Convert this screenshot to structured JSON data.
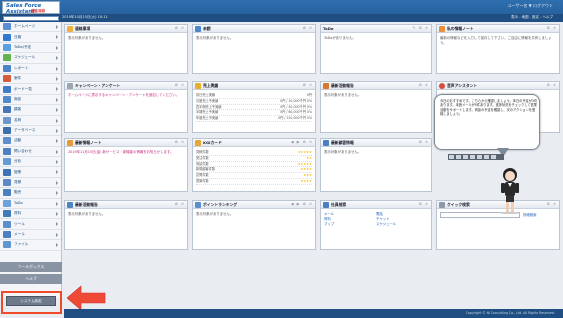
{
  "header": {
    "logo": "Sales Force Assistant",
    "logo_sub": "顧客深耕",
    "user": "ユーザー名 ▼  ログアウト",
    "info": "2019年10月15日(火) 10:11",
    "right_info": "表示 - 地図 - 設定 - ヘルプ"
  },
  "search": {
    "placeholder": ""
  },
  "sidebar": {
    "items": [
      {
        "label": "ホームページ",
        "color": "#5b8fd1"
      },
      {
        "label": "日報",
        "color": "#2f7ad0"
      },
      {
        "label": "ToDo/予定",
        "color": "#58a0e0"
      },
      {
        "label": "スケジュール",
        "color": "#62b24e"
      },
      {
        "label": "レポート",
        "color": "#4a83c6"
      },
      {
        "label": "案件",
        "color": "#d45b3c"
      },
      {
        "label": "ボード一覧",
        "color": "#3d7cc9"
      },
      {
        "label": "商談",
        "color": "#5189cc"
      },
      {
        "label": "顧客",
        "color": "#4577b8"
      },
      {
        "label": "名刺",
        "color": "#6b97cc"
      },
      {
        "label": "データベース",
        "color": "#3b6fae"
      },
      {
        "label": "活動",
        "color": "#5d8fcf"
      },
      {
        "label": "問い合わせ",
        "color": "#4f80bf"
      },
      {
        "label": "分析",
        "color": "#6799d4"
      },
      {
        "label": "施策",
        "color": "#3e74b5"
      },
      {
        "label": "見積",
        "color": "#5a8bc8"
      },
      {
        "label": "販売",
        "color": "#4c7fbd"
      },
      {
        "label": "ToDo",
        "color": "#6ea0d9"
      },
      {
        "label": "資料",
        "color": "#437ab9"
      },
      {
        "label": "ツール",
        "color": "#5b8ecb"
      },
      {
        "label": "メール",
        "color": "#4b7fbf"
      },
      {
        "label": "ファイル",
        "color": "#6196d2"
      }
    ],
    "gray1": "ツールボックス",
    "gray2": "ヘルプ",
    "system_button": "システム設定"
  },
  "widgets": {
    "w1": {
      "title": "連絡事項",
      "body": "表示対象がありません。"
    },
    "w2": {
      "title": "未読",
      "body": "表示対象がありません。"
    },
    "w3": {
      "title": "ToDo",
      "body": "ToDoがありません。"
    },
    "w4": {
      "title": "私の情報ノート",
      "body": "最新の情報などを入力して保存して下さい。ご自由に情報を共有しましょう。"
    },
    "w5": {
      "title": "キャンペーン・アンケート",
      "body": "ホームページに表示するキャンペーン・アンケートを追加してください。"
    },
    "w6": {
      "title": "売上実績",
      "rows": [
        [
          "前日売上実績",
          "0円"
        ],
        [
          "月度売上予実績",
          "0円 / 10,000千円 0%"
        ],
        [
          "四半期売上予実績",
          "0円 / 30,000千円 0%"
        ],
        [
          "半期売上予実績",
          "0円 / 60,000千円 0%"
        ],
        [
          "年度売上予実績",
          "0円 / 120,000千円 0%"
        ]
      ]
    },
    "w7": {
      "title": "最新活動報告",
      "body": "表示対象がありません。"
    },
    "w8": {
      "title": "音声アシスタント",
      "body": ""
    },
    "w9": {
      "title": "最新情報ノート",
      "body": "2019年11月15日(金) 新サービス・新機能の情報をお知らせします。"
    },
    "w10": {
      "title": "KGIカード",
      "rows": [
        [
          "見積件数",
          "★★★★★"
        ],
        [
          "受注件数",
          "★★"
        ],
        [
          "商談件数",
          "★★★★★"
        ],
        [
          "新規顧客件数",
          "★★★★"
        ],
        [
          "訪問件数",
          "★★★"
        ],
        [
          "提案件数",
          "★★★★"
        ]
      ]
    },
    "w11": {
      "title": "最新顧客情報",
      "body": "表示対象がありません。"
    },
    "w12": {
      "title": "最新活動報告",
      "body": "表示対象がありません。"
    },
    "w13": {
      "title": "最新顧客訪問",
      "body": "表示対象がありません。"
    },
    "w14": {
      "title": "ポイントランキング",
      "body": "表示対象がありません。"
    },
    "w15": {
      "title": "社員検索",
      "items": [
        "メール",
        "電話",
        "資料",
        "チャット",
        "マップ",
        "スケジュール"
      ]
    },
    "w16": {
      "title": "クイック検索",
      "button": "詳細検索"
    }
  },
  "bubble": {
    "text": "今日のおすすめです。こちらから確認しましょう。本日の予定が3件あります。未読メールが5件あります。進捗状況をチェックして営業活動をサポートします。商談の予定を確認し、次のアクションを登録しましょう。"
  },
  "footer": "Copyright © NI Consulting Co., Ltd. All Rights Reserved."
}
